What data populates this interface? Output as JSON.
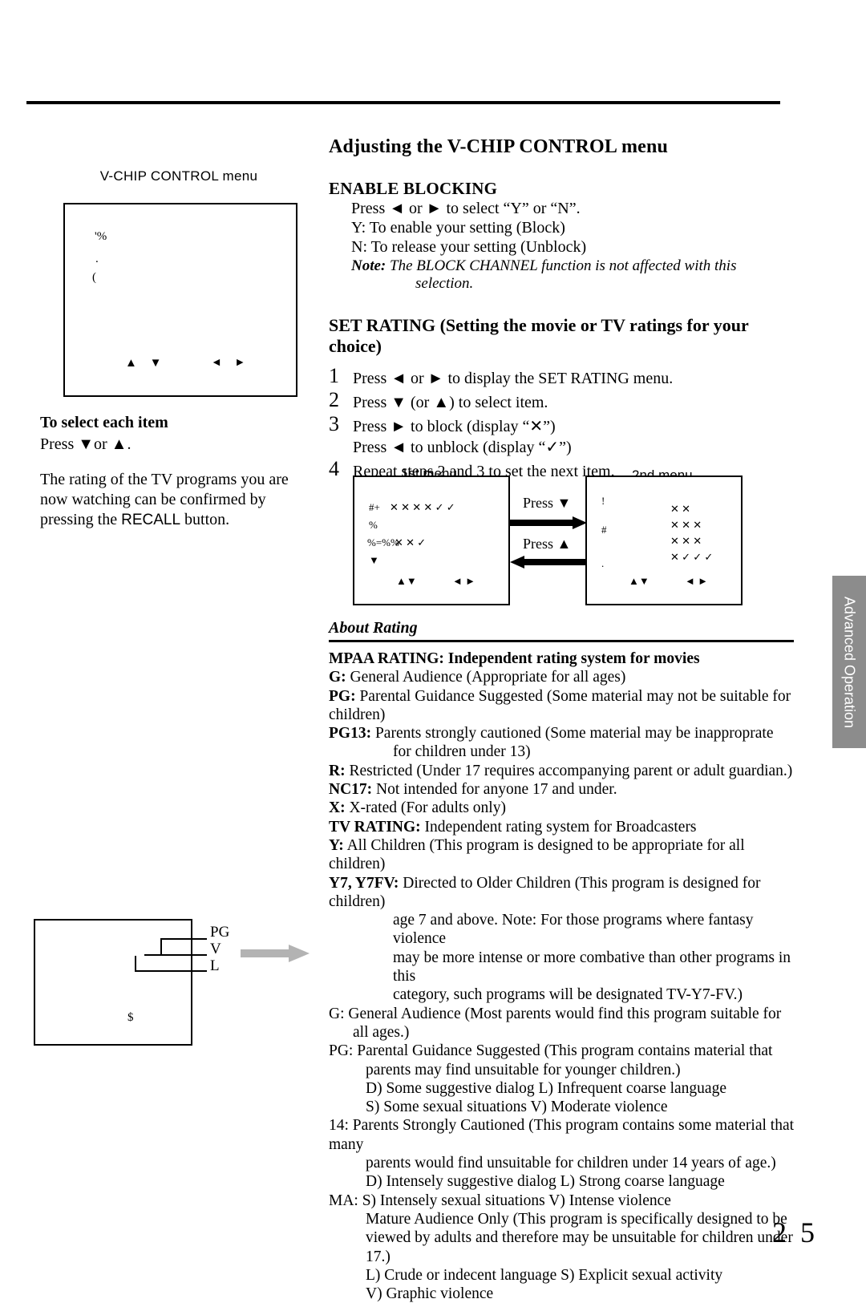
{
  "page": {
    "number": "2 5",
    "side_tab": "Advanced Operation"
  },
  "left": {
    "screen_caption": "V-CHIP CONTROL menu",
    "screen_glyphs": [
      "'%",
      ".",
      "("
    ],
    "arrows_updown": "▲ ▼",
    "arrows_leftright": "◄ ►",
    "select_heading": "To select each item",
    "press_line": "Press ▼or ▲.",
    "paragraph": "The rating of the TV programs you are now watching can be confirmed by pressing the ",
    "recall_word": "RECALL",
    "paragraph_end": " button.",
    "diagram_labels": [
      "PG",
      "V",
      "L"
    ],
    "diagram_symbol": "$"
  },
  "right": {
    "title": "Adjusting the V-CHIP CONTROL menu",
    "enable_blocking": {
      "heading": "ENABLE BLOCKING",
      "lines": [
        "Press ◄ or ► to select “Y” or “N”.",
        "Y: To enable your setting (Block)",
        "N: To release your setting (Unblock)"
      ],
      "note_label": "Note:",
      "note_text": "The BLOCK CHANNEL function is not affected with this",
      "note_text2": "selection."
    },
    "set_rating": {
      "heading": "SET RATING (Setting the movie or TV ratings for your choice)",
      "steps": [
        {
          "num": "1",
          "text": "Press ◄ or ► to display the SET RATING menu."
        },
        {
          "num": "2",
          "text": "Press ▼ (or ▲) to select item."
        },
        {
          "num": "3",
          "text": "Press ► to block (display “✕”)",
          "text2": "Press ◄ to unblock (display “✓”)"
        },
        {
          "num": "4",
          "text": "Repeat steps 2 and 3 to set the next item."
        }
      ]
    },
    "menus": {
      "first_label": "1st  menu",
      "second_label": "2nd menu",
      "press_down": "Press ▼",
      "press_up": "Press ▲",
      "arrows_updown": "▲▼",
      "arrows_leftright": "◄ ►",
      "m1_glyphs": [
        "#+",
        "%",
        "%=%%",
        "▼"
      ],
      "m1_marks_row1": "✕  ✕  ✕  ✕    ✓ ✓",
      "m1_marks_row2": "✕    ✕ ✓",
      "m2_glyphs": [
        "!",
        "#",
        "."
      ],
      "m2_marks": [
        "✕  ✕",
        "✕  ✕  ✕",
        "✕  ✕  ✕",
        "✕  ✓   ✓   ✓"
      ]
    },
    "about_rating_heading": "About Rating",
    "ratings": [
      {
        "bold": "MPAA RATING: Independent rating system for movies",
        "rest": "",
        "indent": 0,
        "all_bold": true
      },
      {
        "bold": "G:",
        "rest": " General Audience (Appropriate for all ages)",
        "indent": 0
      },
      {
        "bold": "PG:",
        "rest": " Parental Guidance Suggested (Some material may not be suitable for children)",
        "indent": 0
      },
      {
        "bold": "PG13:",
        "rest": " Parents strongly cautioned (Some material may be inapproprate",
        "indent": 0
      },
      {
        "bold": "",
        "rest": "for  children under 13)",
        "indent": 3
      },
      {
        "bold": "R:",
        "rest": " Restricted (Under 17 requires accompanying parent or adult guardian.)",
        "indent": 0
      },
      {
        "bold": "NC17:",
        "rest": " Not intended for anyone 17 and under.",
        "indent": 0
      },
      {
        "bold": "X:",
        "rest": " X-rated (For adults only)",
        "indent": 0
      },
      {
        "bold": "TV RATING:",
        "rest": " Independent rating system for Broadcasters",
        "indent": 0
      },
      {
        "bold": "Y:",
        "rest": " All Children (This program is designed to be appropriate for all children)",
        "indent": 0
      },
      {
        "bold": "Y7, Y7FV:",
        "rest": " Directed to Older Children (This program is designed for children)",
        "indent": 0
      },
      {
        "bold": "",
        "rest": "age 7 and above. Note: For those programs where fantasy violence",
        "indent": 3
      },
      {
        "bold": "",
        "rest": "may be more intense or more combative than other programs in this",
        "indent": 3
      },
      {
        "bold": "",
        "rest": "category, such programs will be designated TV-Y7-FV.)",
        "indent": 3
      },
      {
        "bold": "",
        "rest": "G: General Audience (Most parents would find this program suitable for",
        "indent": 0
      },
      {
        "bold": "",
        "rest": "all ages.)",
        "indent": 1
      },
      {
        "bold": "",
        "rest": "PG: Parental Guidance Suggested (This program contains material that",
        "indent": 0
      },
      {
        "bold": "",
        "rest": "parents may find unsuitable for younger children.)",
        "indent": 2
      },
      {
        "bold": "",
        "rest": "D) Some suggestive dialog    L) Infrequent coarse language",
        "indent": 2
      },
      {
        "bold": "",
        "rest": "S) Some sexual situations   V) Moderate violence",
        "indent": 2
      },
      {
        "bold": "",
        "rest": "14: Parents Strongly Cautioned (This program contains some material that many",
        "indent": 0
      },
      {
        "bold": "",
        "rest": "parents would find unsuitable for children under 14 years of age.)",
        "indent": 2
      },
      {
        "bold": "",
        "rest": "D) Intensely suggestive dialog    L) Strong coarse language",
        "indent": 2
      },
      {
        "bold": "",
        "rest": "MA: S) Intensely sexual situations     V) Intense violence",
        "indent": 0
      },
      {
        "bold": "",
        "rest": "Mature Audience Only (This program is specifically designed to be",
        "indent": 2
      },
      {
        "bold": "",
        "rest": "viewed by adults and therefore may be unsuitable for children under 17.)",
        "indent": 2
      },
      {
        "bold": "",
        "rest": "L) Crude or indecent language  S) Explicit sexual activity",
        "indent": 2
      },
      {
        "bold": "",
        "rest": "V) Graphic violence",
        "indent": 2
      }
    ]
  }
}
